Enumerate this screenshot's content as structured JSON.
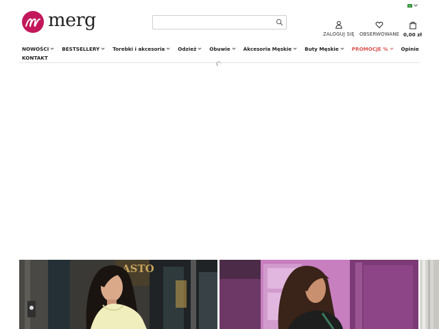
{
  "brand": {
    "name": "merg",
    "accent": "#c2185b"
  },
  "language": {
    "flag_color": "#4caf50",
    "icon": "chevron-down-icon"
  },
  "search": {
    "placeholder": "",
    "value": "",
    "icon": "search-icon"
  },
  "header_actions": {
    "login": {
      "label": "ZALOGUJ SIĘ",
      "icon": "user-icon"
    },
    "wishlist": {
      "label": "OBSERWOWANE",
      "icon": "heart-icon"
    },
    "cart": {
      "label": "0,00 zł",
      "icon": "shopping-bag-icon"
    }
  },
  "nav": [
    {
      "label": "NOWOŚCI",
      "dropdown": true
    },
    {
      "label": "BESTSELLERY",
      "dropdown": true
    },
    {
      "label": "Torebki i akcesoria",
      "dropdown": true
    },
    {
      "label": "Odzież",
      "dropdown": true
    },
    {
      "label": "Obuwie",
      "dropdown": true
    },
    {
      "label": "Akcesoria Męskie",
      "dropdown": true
    },
    {
      "label": "Buty Męskie",
      "dropdown": true
    },
    {
      "label": "PROMOCJE %",
      "dropdown": true,
      "color": "#d9534f"
    },
    {
      "label": "Opinie",
      "dropdown": false
    },
    {
      "label": "KONTAKT",
      "dropdown": false
    }
  ],
  "banners": [
    {
      "shop_sign": "ASTO"
    },
    {
      "shop_sign": ""
    },
    {
      "shop_sign": ""
    }
  ]
}
